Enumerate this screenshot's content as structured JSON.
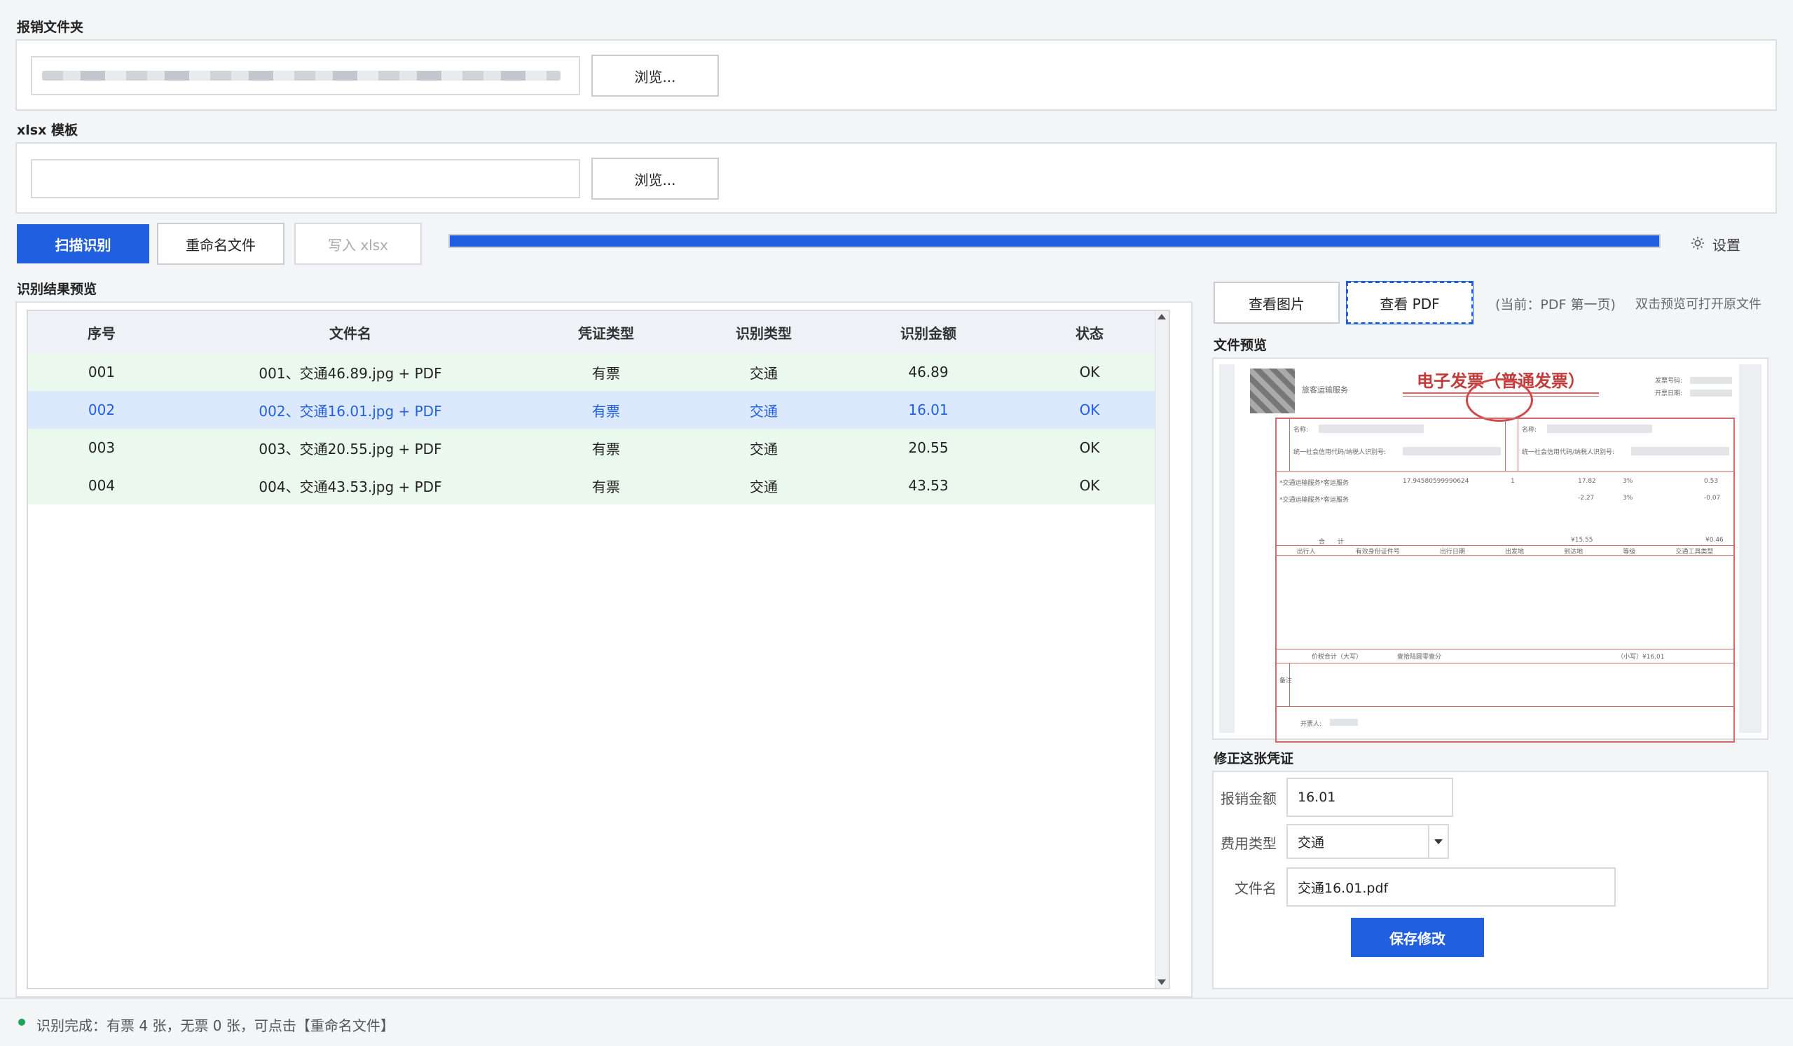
{
  "folder_section": {
    "title": "报销文件夹",
    "browse_label": "浏览..."
  },
  "template_section": {
    "title": "xlsx 模板",
    "browse_label": "浏览..."
  },
  "toolbar": {
    "scan_label": "扫描识别",
    "rename_label": "重命名文件",
    "write_label": "写入 xlsx",
    "progress": 1.0,
    "settings_label": "设置"
  },
  "results": {
    "title": "识别结果预览",
    "columns": [
      "序号",
      "文件名",
      "凭证类型",
      "识别类型",
      "识别金额",
      "状态"
    ],
    "rows": [
      {
        "no": "001",
        "file": "001、交通46.89.jpg + PDF",
        "voucher": "有票",
        "type": "交通",
        "amount": "46.89",
        "status": "OK"
      },
      {
        "no": "002",
        "file": "002、交通16.01.jpg + PDF",
        "voucher": "有票",
        "type": "交通",
        "amount": "16.01",
        "status": "OK"
      },
      {
        "no": "003",
        "file": "003、交通20.55.jpg + PDF",
        "voucher": "有票",
        "type": "交通",
        "amount": "20.55",
        "status": "OK"
      },
      {
        "no": "004",
        "file": "004、交通43.53.jpg + PDF",
        "voucher": "有票",
        "type": "交通",
        "amount": "43.53",
        "status": "OK"
      }
    ]
  },
  "preview": {
    "view_image_label": "查看图片",
    "view_pdf_label": "查看 PDF",
    "current_label": "(当前：PDF 第一页)",
    "hint": "双击预览可打开原文件",
    "title": "文件预览",
    "invoice": {
      "heading": "电子发票（普通发票）",
      "service": "旅客运输服务",
      "buyer_label": "名称:",
      "seller_label": "名称:",
      "tax_id_label": "统一社会信用代码/纳税人识别号:",
      "item1": "*交通运输服务*客运服务",
      "item2": "*交通运输服务*客运服务",
      "unit_price": "17.94580599990624",
      "qty": "1",
      "amount1": "17.82",
      "tax_rate1": "3%",
      "tax1": "0.53",
      "amount2": "-2.27",
      "tax_rate2": "3%",
      "tax2": "-0.07",
      "total_label": "合　　计",
      "total_amount": "¥15.55",
      "total_tax": "¥0.46",
      "cols_bottom": [
        "出行人",
        "有效身份证件号",
        "出行日期",
        "出发地",
        "到达地",
        "等级",
        "交通工具类型"
      ],
      "grand_label": "价税合计（大写）",
      "grand_cn": "壹拾陆圆零壹分",
      "grand_small": "（小写）¥16.01",
      "remark_label": "备注",
      "issuer_label": "开票人:",
      "code_label": "发票号码:",
      "date_label": "开票日期:"
    }
  },
  "correction": {
    "title": "修正这张凭证",
    "amount_label": "报销金额",
    "amount_value": "16.01",
    "type_label": "费用类型",
    "type_value": "交通",
    "filename_label": "文件名",
    "filename_value": "交通16.01.pdf",
    "save_label": "保存修改"
  },
  "status_bar": {
    "text": "识别完成：有票 4 张，无票 0 张，可点击【重命名文件】"
  }
}
